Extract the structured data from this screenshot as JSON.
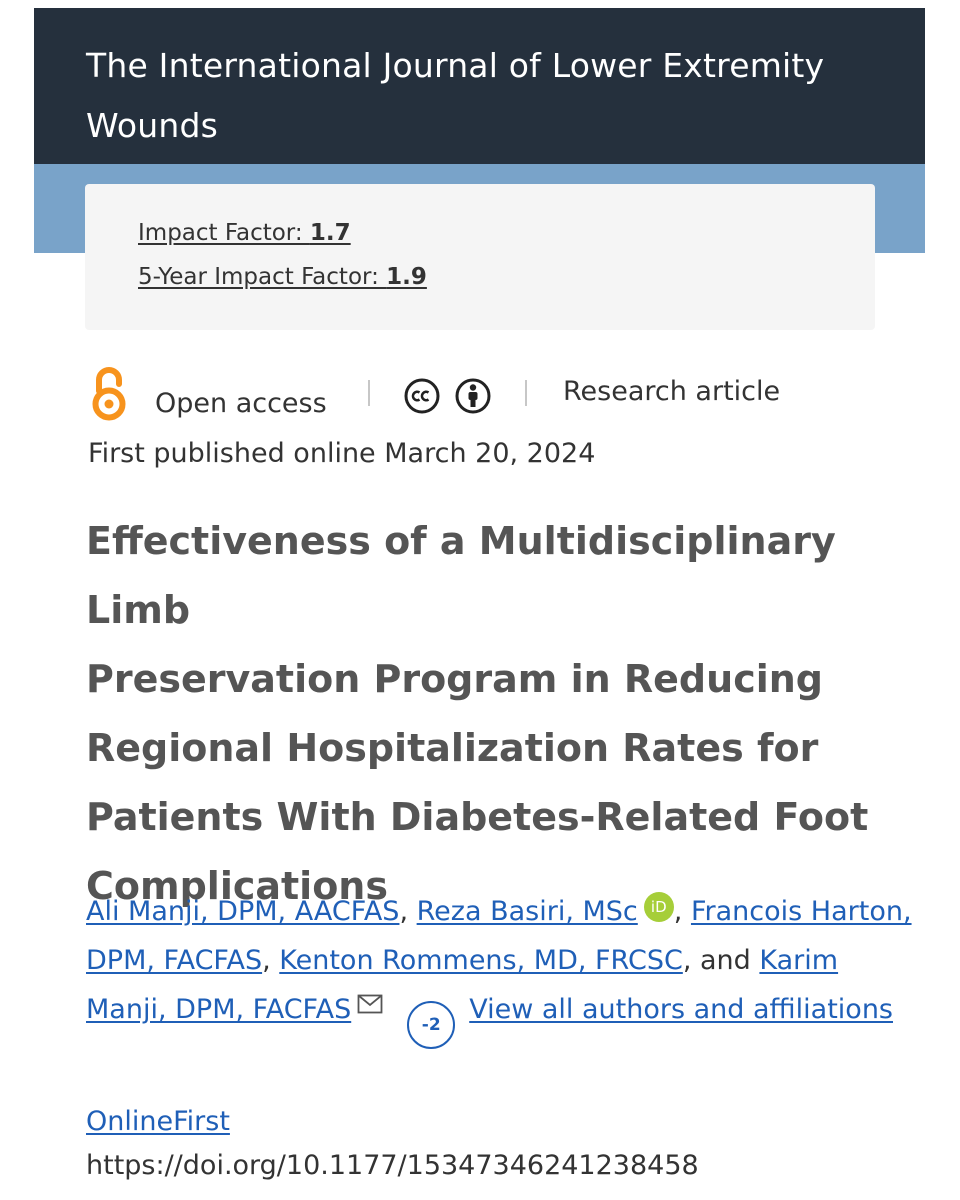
{
  "journal": {
    "title_line1": "The International Journal of Lower Extremity",
    "title_line2": "Wounds"
  },
  "metrics": {
    "impact_factor_label": "Impact Factor: ",
    "impact_factor_value": "1.7",
    "five_year_label": "5-Year Impact Factor: ",
    "five_year_value": "1.9"
  },
  "access": {
    "open_access_label": "Open access",
    "article_type": "Research article",
    "icons": [
      "open-access-icon",
      "creative-commons-icon",
      "attribution-icon"
    ]
  },
  "published": "First published online March 20, 2024",
  "article": {
    "title_lines": [
      "Effectiveness of a Multidisciplinary Limb",
      "Preservation Program in Reducing",
      "Regional Hospitalization Rates for",
      "Patients With Diabetes-Related Foot",
      "Complications"
    ]
  },
  "authors": {
    "list": [
      "Ali Manji, DPM, AACFAS",
      "Reza Basiri, MSc",
      "Francois Harton, DPM, FACFAS",
      "Kenton Rommens, MD, FRCSC",
      "Karim Manji, DPM, FACFAS"
    ],
    "separator": ", ",
    "and_text": ", and",
    "orcid_label": "iD",
    "more_count": "-2",
    "view_all": "View all authors and affiliations"
  },
  "online_first": "OnlineFirst",
  "doi": "https://doi.org/10.1177/15347346241238458",
  "colors": {
    "header_bg": "#25303d",
    "band_bg": "#79a3c9",
    "metrics_bg": "#f5f5f5",
    "link": "#1f5fb7",
    "open_access": "#f7931d",
    "orcid": "#a6ce39"
  }
}
